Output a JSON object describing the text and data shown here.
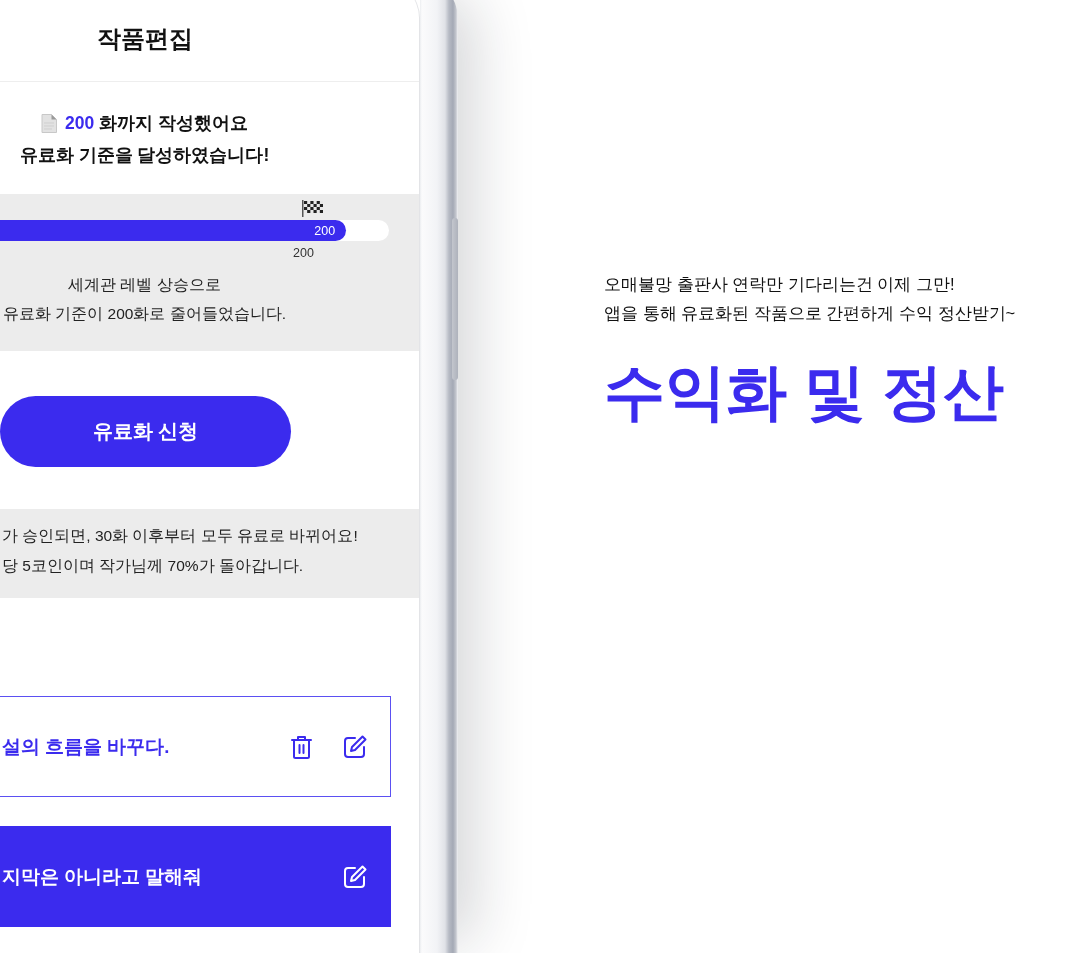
{
  "phone": {
    "title": "작품편집",
    "summary": {
      "count": "200",
      "text": "화까지 작성했어요",
      "message": "유료화 기준을 달성하였습니다!"
    },
    "progress": {
      "level": 0.89,
      "value": "200",
      "goal": "200",
      "note": "세계관 레벨 상승으로\n유료화 기준이 200화로 줄어들었습니다."
    },
    "apply_button": "유료화 신청",
    "info_lines": [
      "가 승인되면, 30화 이후부터 모두 유료로 바뀌어요!",
      "당 5코인이며 작가님께 70%가 돌아갑니다."
    ],
    "episodes": [
      {
        "title": "설의 흐름을 바꾸다.",
        "selected": false,
        "deletable": true
      },
      {
        "title": "지막은 아니라고 말해줘",
        "selected": true,
        "deletable": false
      }
    ]
  },
  "promo": {
    "lines": [
      "오매불망 출판사 연락만 기다리는건 이제 그만!",
      "앱을 통해 유료화된 작품으로 간편하게 수익 정산받기~"
    ],
    "headline": "수익화 및 정산"
  }
}
